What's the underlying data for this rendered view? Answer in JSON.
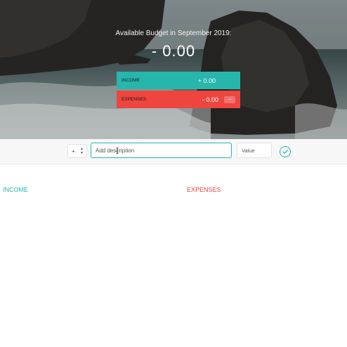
{
  "budget": {
    "title": "Available Budget in September 2019:",
    "value": "- 0.00"
  },
  "summary": {
    "income_label": "Income",
    "income_value": "+ 0.00",
    "expenses_label": "Expenses",
    "expenses_value": "- 0.00",
    "expenses_percentage": "---"
  },
  "add": {
    "type_value": "+",
    "description_placeholder": "Add description",
    "value_placeholder": "Value"
  },
  "lists": {
    "income_title": "Income",
    "expenses_title": "Expenses"
  },
  "colors": {
    "income": "#27b6ab",
    "expenses": "#ee453e"
  },
  "icons": {
    "submit": "check-circle-icon",
    "type_arrows": "up-down-arrows-icon"
  }
}
